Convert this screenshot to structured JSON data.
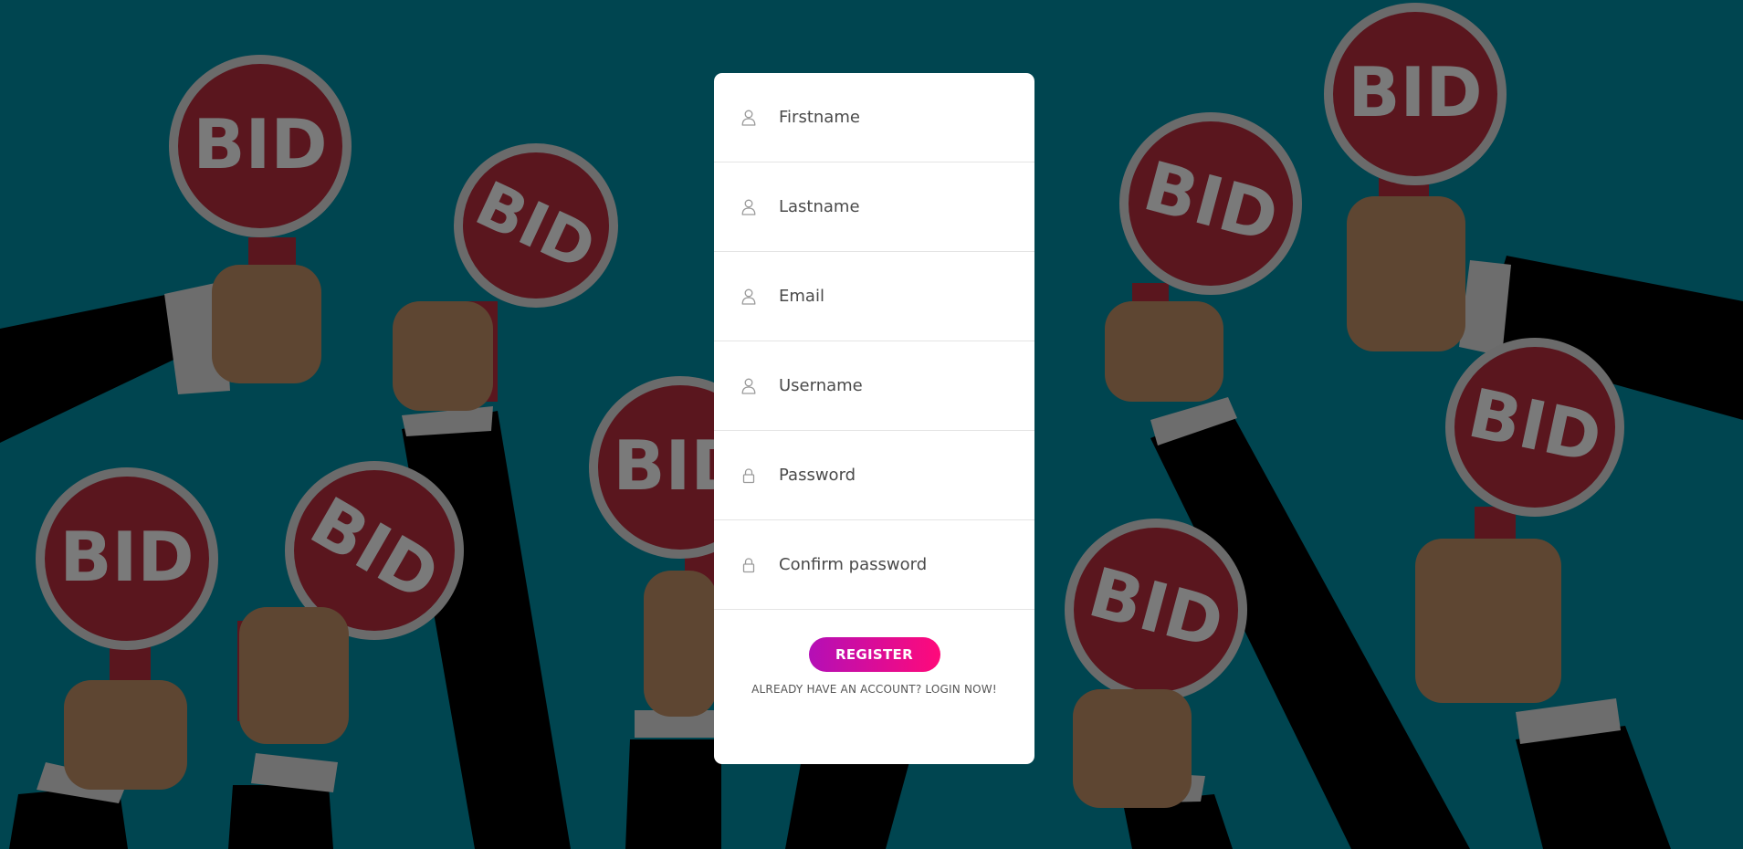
{
  "background": {
    "paddle_text": "BID",
    "colors": {
      "backdrop": "#004550",
      "paddle": "#5a161e",
      "paddle_rim": "#6b6b6b",
      "paddle_text": "#7a7a7a",
      "sleeve": "#000000",
      "cuff": "#6d6d6d",
      "hand": "#5e4632"
    }
  },
  "form": {
    "fields": [
      {
        "name": "firstname",
        "icon": "user-icon",
        "placeholder": "Firstname",
        "type": "text",
        "value": ""
      },
      {
        "name": "lastname",
        "icon": "user-icon",
        "placeholder": "Lastname",
        "type": "text",
        "value": ""
      },
      {
        "name": "email",
        "icon": "user-icon",
        "placeholder": "Email",
        "type": "text",
        "value": ""
      },
      {
        "name": "username",
        "icon": "user-icon",
        "placeholder": "Username",
        "type": "text",
        "value": ""
      },
      {
        "name": "password",
        "icon": "lock-icon",
        "placeholder": "Password",
        "type": "password",
        "value": ""
      },
      {
        "name": "confirm_password",
        "icon": "lock-icon",
        "placeholder": "Confirm password",
        "type": "password",
        "value": ""
      }
    ],
    "register_label": "REGISTER",
    "login_link_label": "ALREADY HAVE AN ACCOUNT? LOGIN NOW!",
    "colors": {
      "button_start": "#b40fb6",
      "button_end": "#ff0a7a",
      "icon": "#9a9a9a"
    }
  }
}
